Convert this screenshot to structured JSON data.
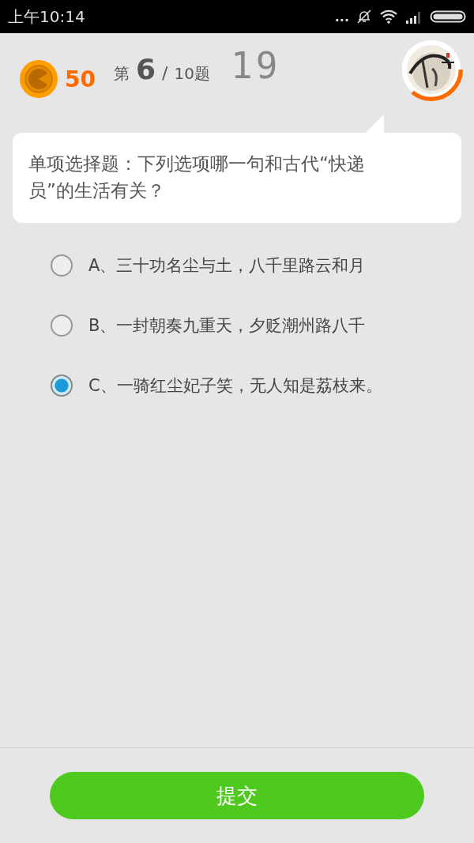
{
  "status_bar": {
    "time": "上午10:14",
    "overflow": "..."
  },
  "header": {
    "score": "50",
    "progress_prefix": "第",
    "current": "6",
    "separator": "/",
    "total": "10题",
    "timer": "19"
  },
  "question": {
    "text": "单项选择题：下列选项哪一句和古代“快递员”的生活有关？"
  },
  "options": [
    {
      "label": "A、三十功名尘与土，八千里路云和月",
      "selected": false
    },
    {
      "label": "B、一封朝奏九重天，夕贬潮州路八千",
      "selected": false
    },
    {
      "label": "C、一骑红尘妃子笑，无人知是荔枝来。",
      "selected": true
    }
  ],
  "submit": {
    "label": "提交"
  }
}
